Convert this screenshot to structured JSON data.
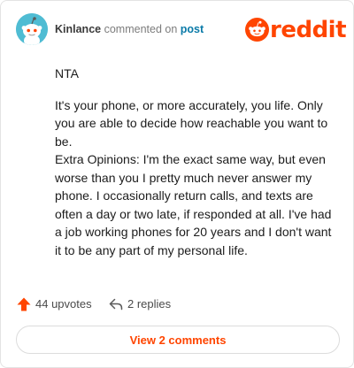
{
  "comment": {
    "username": "Kinlance",
    "action_text": "commented on",
    "target_link": "post",
    "paragraphs": [
      "NTA",
      "It's your phone, or more accurately, you life. Only you are able to decide how reachable you want to be.",
      "Extra Opinions: I'm the exact same way, but even worse than you I pretty much never answer my phone. I occasionally return calls, and texts are often a day or two late, if responded at all. I've had a job working phones for 20 years and I don't want it to be any part of my personal life."
    ]
  },
  "brand": {
    "wordmark": "reddit",
    "color": "#ff4500"
  },
  "actions": {
    "upvotes_label": "44 upvotes",
    "replies_label": "2 replies"
  },
  "footer": {
    "view_comments_label": "View 2 comments"
  },
  "icons": {
    "avatar": "snoo-avatar-icon",
    "logo": "reddit-snoo-icon",
    "upvote": "upvote-arrow-icon",
    "reply": "reply-arrow-icon"
  }
}
